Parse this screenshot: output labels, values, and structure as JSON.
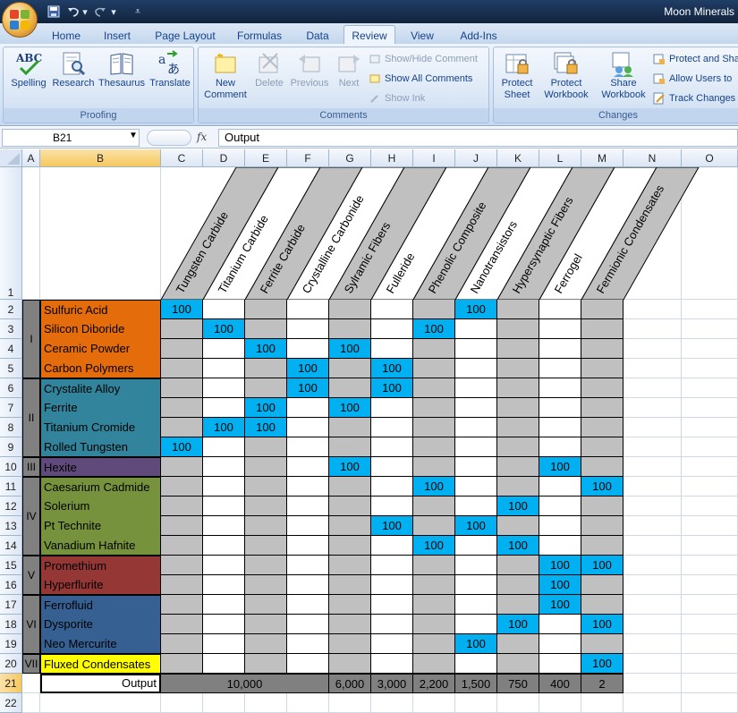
{
  "window": {
    "title": "Moon Minerals"
  },
  "tabs": [
    "Home",
    "Insert",
    "Page Layout",
    "Formulas",
    "Data",
    "Review",
    "View",
    "Add-Ins"
  ],
  "active_tab": "Review",
  "ribbon": {
    "proofing": {
      "label": "Proofing",
      "spelling": "Spelling",
      "research": "Research",
      "thesaurus": "Thesaurus",
      "translate": "Translate"
    },
    "comments": {
      "label": "Comments",
      "new_comment": "New Comment",
      "delete": "Delete",
      "previous": "Previous",
      "next": "Next",
      "show_hide": "Show/Hide Comment",
      "show_all": "Show All Comments",
      "show_ink": "Show Ink"
    },
    "changes": {
      "label": "Changes",
      "protect_sheet": "Protect Sheet",
      "protect_workbook": "Protect Workbook",
      "share_workbook": "Share Workbook",
      "protect_share": "Protect and Sha",
      "allow_users": "Allow Users to",
      "track_changes": "Track Changes"
    }
  },
  "formula_bar": {
    "name_box": "B21",
    "fx": "fx",
    "content": "Output"
  },
  "columns": [
    "A",
    "B",
    "C",
    "D",
    "E",
    "F",
    "G",
    "H",
    "I",
    "J",
    "K",
    "L",
    "M",
    "N",
    "O"
  ],
  "rows": [
    "1",
    "2",
    "3",
    "4",
    "5",
    "6",
    "7",
    "8",
    "9",
    "10",
    "11",
    "12",
    "13",
    "14",
    "15",
    "16",
    "17",
    "18",
    "19",
    "20",
    "21",
    "22"
  ],
  "products": [
    "Tungsten Carbide",
    "Titanium Carbide",
    "Ferrite Carbide",
    "Crystalline Carbonide",
    "Sylramic Fibers",
    "Fulleride",
    "Phenolic Composite",
    "Nanotransistors",
    "Hypersynaptic Fibers",
    "Ferrogel",
    "Fermionic Condensates"
  ],
  "tiers": [
    {
      "roman": "I",
      "color": "#e46c0a",
      "minerals": [
        "Sulfuric Acid",
        "Silicon Diboride",
        "Ceramic Powder",
        "Carbon Polymers"
      ]
    },
    {
      "roman": "II",
      "color": "#31849b",
      "minerals": [
        "Crystalite Alloy",
        "Ferrite",
        "Titanium Cromide",
        "Rolled Tungsten"
      ]
    },
    {
      "roman": "III",
      "color": "#604a7b",
      "minerals": [
        "Hexite"
      ]
    },
    {
      "roman": "IV",
      "color": "#76923c",
      "minerals": [
        "Caesarium Cadmide",
        "Solerium",
        "Pt Technite",
        "Vanadium Hafnite"
      ]
    },
    {
      "roman": "V",
      "color": "#953735",
      "minerals": [
        "Promethium",
        "Hyperflurite"
      ]
    },
    {
      "roman": "VI",
      "color": "#366092",
      "minerals": [
        "Ferrofluid",
        "Dysporite",
        "Neo Mercurite"
      ]
    },
    {
      "roman": "VII",
      "color": "#ffff00",
      "minerals": [
        "Fluxed Condensates"
      ]
    }
  ],
  "cell_value": "100",
  "matrix": [
    [
      0,
      7
    ],
    [
      1,
      6
    ],
    [
      2,
      4
    ],
    [
      3,
      5
    ],
    [
      5,
      3
    ],
    [
      4,
      2
    ],
    [
      2,
      1
    ],
    [
      0,
      0
    ],
    [
      4,
      9
    ],
    [
      6,
      10
    ],
    [
      8
    ],
    [
      5,
      7
    ],
    [
      6,
      8
    ],
    [
      9,
      10
    ],
    [
      9
    ],
    [
      9
    ],
    [
      8,
      10
    ],
    [
      7
    ],
    [
      10
    ]
  ],
  "output": {
    "label": "Output",
    "merged_value": "10,000",
    "values": [
      "6,000",
      "3,000",
      "2,200",
      "1,500",
      "750",
      "400",
      "2"
    ]
  },
  "colors": {
    "cell_blue": "#00b0f0",
    "gray": "#c0c0c0",
    "output_gray": "#808080",
    "selection": "#f6c85e"
  }
}
